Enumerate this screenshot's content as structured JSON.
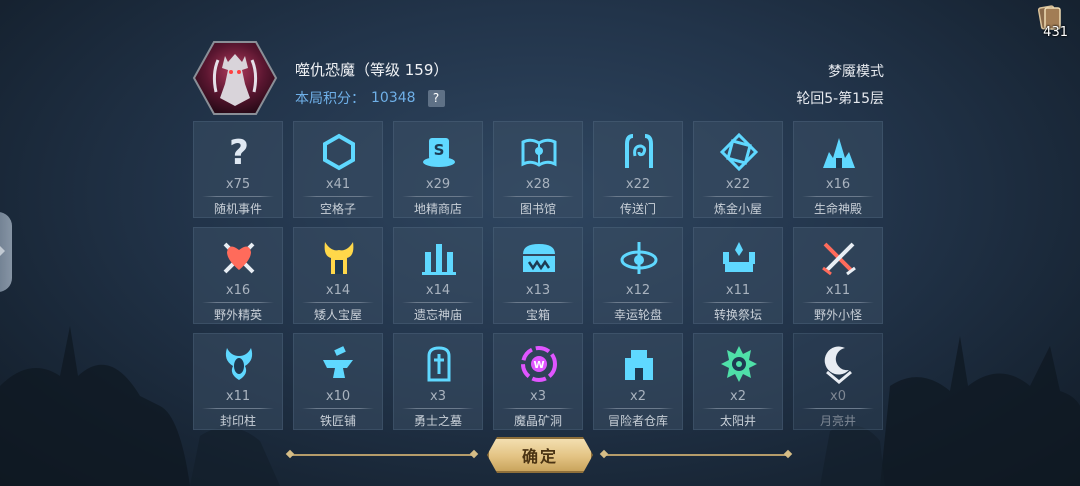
{
  "header": {
    "boss_name": "噬仇恐魔（等级 159）",
    "score_label": "本局积分：",
    "score_value": "10348",
    "help_label": "?",
    "mode": "梦魇模式",
    "floor": "轮回5-第15层"
  },
  "card_counter": {
    "value": "431"
  },
  "cells": [
    {
      "name": "随机事件",
      "qty": "x75",
      "icon": "question-icon",
      "color": "#dfe8f2"
    },
    {
      "name": "空格子",
      "qty": "x41",
      "icon": "hexagon-icon",
      "color": "#5fd8ff"
    },
    {
      "name": "地精商店",
      "qty": "x29",
      "icon": "shop-icon",
      "color": "#5fd8ff"
    },
    {
      "name": "图书馆",
      "qty": "x28",
      "icon": "book-icon",
      "color": "#5fd8ff"
    },
    {
      "name": "传送门",
      "qty": "x22",
      "icon": "portal-icon",
      "color": "#5fd8ff"
    },
    {
      "name": "炼金小屋",
      "qty": "x22",
      "icon": "alchemy-icon",
      "color": "#5fd8ff"
    },
    {
      "name": "生命神殿",
      "qty": "x16",
      "icon": "temple-icon",
      "color": "#5fd8ff"
    },
    {
      "name": "野外精英",
      "qty": "x16",
      "icon": "elite-icon",
      "color": "#ff6b5b"
    },
    {
      "name": "矮人宝屋",
      "qty": "x14",
      "icon": "dwarf-icon",
      "color": "#ffd84a"
    },
    {
      "name": "遗忘神庙",
      "qty": "x14",
      "icon": "forgotten-temple-icon",
      "color": "#5fd8ff"
    },
    {
      "name": "宝箱",
      "qty": "x13",
      "icon": "chest-icon",
      "color": "#5fd8ff"
    },
    {
      "name": "幸运轮盘",
      "qty": "x12",
      "icon": "wheel-icon",
      "color": "#5fd8ff"
    },
    {
      "name": "转换祭坛",
      "qty": "x11",
      "icon": "altar-icon",
      "color": "#5fd8ff"
    },
    {
      "name": "野外小怪",
      "qty": "x11",
      "icon": "crossed-swords-icon",
      "color": "#ff6b5b"
    },
    {
      "name": "封印柱",
      "qty": "x11",
      "icon": "seal-pillar-icon",
      "color": "#5fd8ff"
    },
    {
      "name": "铁匠铺",
      "qty": "x10",
      "icon": "anvil-icon",
      "color": "#5fd8ff"
    },
    {
      "name": "勇士之墓",
      "qty": "x3",
      "icon": "tomb-icon",
      "color": "#5fd8ff"
    },
    {
      "name": "魔晶矿洞",
      "qty": "x3",
      "icon": "crystal-mine-icon",
      "color": "#e055ff"
    },
    {
      "name": "冒险者仓库",
      "qty": "x2",
      "icon": "warehouse-icon",
      "color": "#5fd8ff"
    },
    {
      "name": "太阳井",
      "qty": "x2",
      "icon": "sunwell-icon",
      "color": "#4fe0a8"
    },
    {
      "name": "月亮井",
      "qty": "x0",
      "icon": "moonwell-icon",
      "color": "#e8ecf2",
      "dim": true
    }
  ],
  "confirm_label": "确定"
}
